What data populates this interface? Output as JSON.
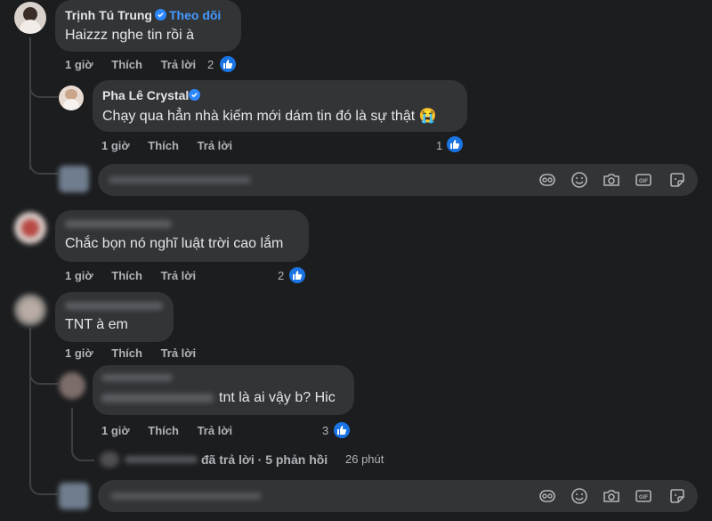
{
  "comments": [
    {
      "author": "Trịnh Tú Trung",
      "follow_label": "Theo dõi",
      "text": "Haizzz nghe tin rồi à",
      "time": "1 giờ",
      "like_action": "Thích",
      "reply_action": "Trả lời",
      "likes": "2",
      "verified": true
    },
    {
      "author": "Pha Lê Crystal",
      "text": "Chạy qua hẳn nhà kiếm mới dám tin đó là sự thật 😭",
      "time": "1 giờ",
      "like_action": "Thích",
      "reply_action": "Trả lời",
      "likes": "1",
      "verified": true
    },
    {
      "author": "",
      "text": "Chắc bọn nó nghĩ luật trời cao lắm",
      "time": "1 giờ",
      "like_action": "Thích",
      "reply_action": "Trả lời",
      "likes": "2"
    },
    {
      "author": "",
      "text": "TNT à em",
      "time": "1 giờ",
      "like_action": "Thích",
      "reply_action": "Trả lời"
    },
    {
      "author": "",
      "text": "tnt là ai vậy b? Hic",
      "time": "1 giờ",
      "like_action": "Thích",
      "reply_action": "Trả lời",
      "likes": "3"
    }
  ],
  "replies_summary": {
    "text": "đã trả lời · 5 phản hồi",
    "time": "26 phút"
  },
  "reply_input": {
    "tools": [
      "emoji-sticker-icon",
      "smiley-icon",
      "camera-icon",
      "gif-icon",
      "sticker-icon"
    ]
  },
  "colors": {
    "background": "#1c1d1f",
    "bubble": "#333436",
    "accent": "#1b74e4",
    "follow_link": "#4599ff"
  }
}
